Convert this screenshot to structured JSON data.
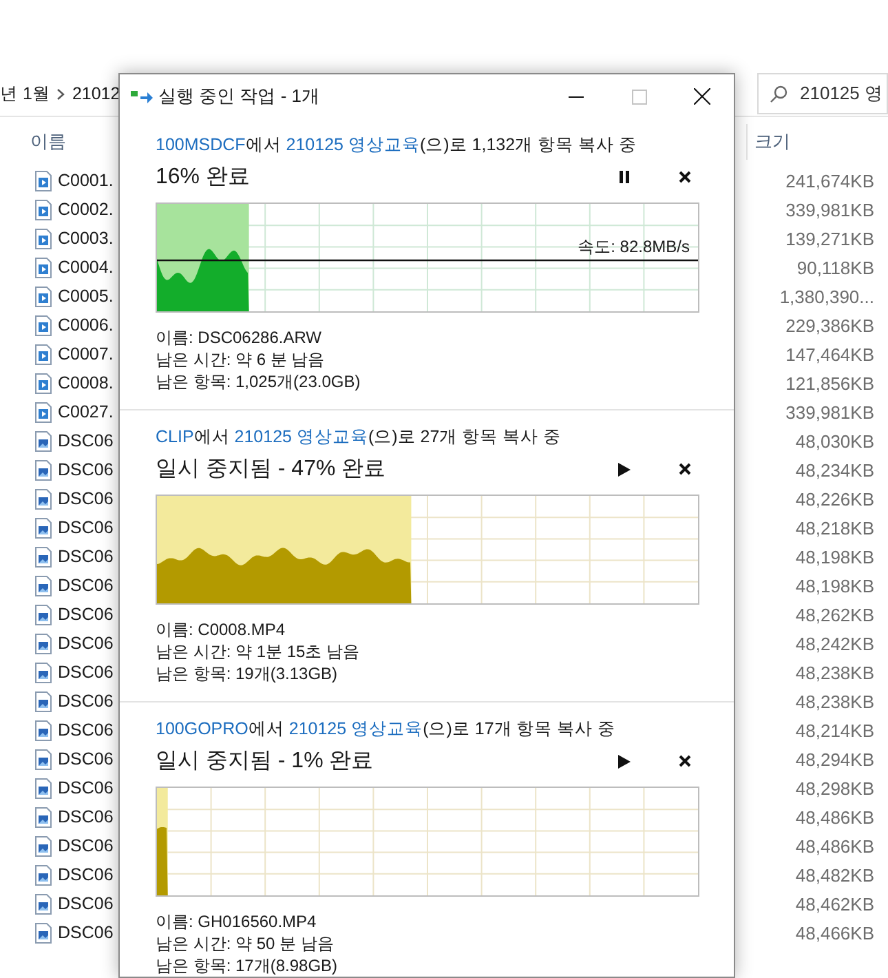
{
  "explorer": {
    "breadcrumb": [
      "년 1월",
      "21012"
    ],
    "search": {
      "value": "210125 영"
    },
    "columns": [
      "이름",
      "크기"
    ],
    "files": [
      {
        "name": "C0001.",
        "size": "241,674KB",
        "kind": "video"
      },
      {
        "name": "C0002.",
        "size": "339,981KB",
        "kind": "video"
      },
      {
        "name": "C0003.",
        "size": "139,271KB",
        "kind": "video"
      },
      {
        "name": "C0004.",
        "size": "90,118KB",
        "kind": "video"
      },
      {
        "name": "C0005.",
        "size": "1,380,390...",
        "kind": "video"
      },
      {
        "name": "C0006.",
        "size": "229,386KB",
        "kind": "video"
      },
      {
        "name": "C0007.",
        "size": "147,464KB",
        "kind": "video"
      },
      {
        "name": "C0008.",
        "size": "121,856KB",
        "kind": "video"
      },
      {
        "name": "C0027.",
        "size": "339,981KB",
        "kind": "video"
      },
      {
        "name": "DSC06",
        "size": "48,030KB",
        "kind": "image"
      },
      {
        "name": "DSC06",
        "size": "48,234KB",
        "kind": "image"
      },
      {
        "name": "DSC06",
        "size": "48,226KB",
        "kind": "image"
      },
      {
        "name": "DSC06",
        "size": "48,218KB",
        "kind": "image"
      },
      {
        "name": "DSC06",
        "size": "48,198KB",
        "kind": "image"
      },
      {
        "name": "DSC06",
        "size": "48,198KB",
        "kind": "image"
      },
      {
        "name": "DSC06",
        "size": "48,262KB",
        "kind": "image"
      },
      {
        "name": "DSC06",
        "size": "48,242KB",
        "kind": "image"
      },
      {
        "name": "DSC06",
        "size": "48,238KB",
        "kind": "image"
      },
      {
        "name": "DSC06",
        "size": "48,238KB",
        "kind": "image"
      },
      {
        "name": "DSC06",
        "size": "48,214KB",
        "kind": "image"
      },
      {
        "name": "DSC06",
        "size": "48,294KB",
        "kind": "image"
      },
      {
        "name": "DSC06",
        "size": "48,298KB",
        "kind": "image"
      },
      {
        "name": "DSC06",
        "size": "48,486KB",
        "kind": "image"
      },
      {
        "name": "DSC06",
        "size": "48,486KB",
        "kind": "image"
      },
      {
        "name": "DSC06",
        "size": "48,482KB",
        "kind": "image"
      },
      {
        "name": "DSC06",
        "size": "48,462KB",
        "kind": "image"
      },
      {
        "name": "DSC06",
        "size": "48,466KB",
        "kind": "image"
      }
    ]
  },
  "dialog": {
    "title": "실행 중인 작업 - 1개",
    "maximize_disabled": true,
    "operations": [
      {
        "source": "100MSDCF",
        "from_word": "에서",
        "destination": "210125 영상교육",
        "suffix": "(으)로 1,132개 항목 복사 중",
        "status": "16% 완료",
        "paused": false,
        "level": 0.17,
        "speed": "속도: 82.8MB/s",
        "details": [
          "이름: DSC06286.ARW",
          "남은 시간: 약 6 분 남음",
          "남은 항목: 1,025개(23.0GB)"
        ]
      },
      {
        "source": "CLIP",
        "from_word": "에서",
        "destination": "210125 영상교육",
        "suffix": "(으)로 27개 항목 복사 중",
        "status": "일시 중지됨 - 47% 완료",
        "paused": true,
        "level": 0.47,
        "details": [
          "이름: C0008.MP4",
          "남은 시간: 약 1분 15초 남음",
          "남은 항목: 19개(3.13GB)"
        ]
      },
      {
        "source": "100GOPRO",
        "from_word": "에서",
        "destination": "210125 영상교육",
        "suffix": "(으)로 17개 항목 복사 중",
        "status": "일시 중지됨 - 1% 완료",
        "paused": true,
        "level": 0.02,
        "details": [
          "이름: GH016560.MP4",
          "남은 시간: 약 50 분 남음",
          "남은 항목: 17개(8.98GB)"
        ]
      }
    ]
  }
}
